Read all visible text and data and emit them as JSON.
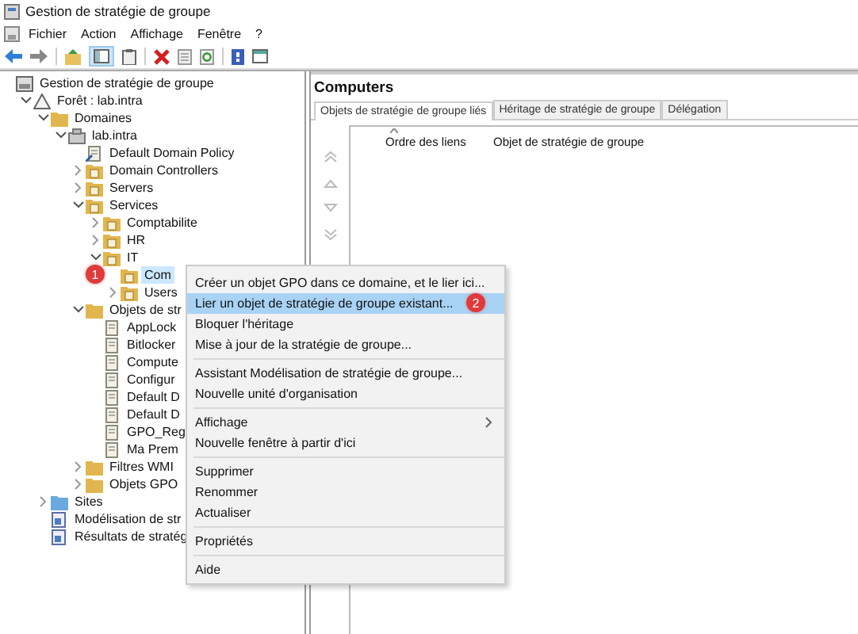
{
  "window": {
    "title": "Gestion de stratégie de groupe"
  },
  "menu_bar": [
    "Fichier",
    "Action",
    "Affichage",
    "Fenêtre",
    "?"
  ],
  "toolbar": {
    "console_tree_shown": true
  },
  "tree": [
    {
      "label": "Gestion de stratégie de groupe",
      "kind": "root",
      "selected": false,
      "children": [
        {
          "label": "Forêt : lab.intra",
          "kind": "forest",
          "expanded": true,
          "selected": false,
          "children": [
            {
              "label": "Domaines",
              "kind": "container",
              "expanded": true,
              "selected": false,
              "children": [
                {
                  "label": "lab.intra",
                  "kind": "domain",
                  "expanded": true,
                  "selected": false,
                  "children": [
                    {
                      "label": "Default Domain Policy",
                      "kind": "link",
                      "selected": false
                    },
                    {
                      "label": "Domain Controllers",
                      "kind": "ou",
                      "expanded": false,
                      "selected": false
                    },
                    {
                      "label": "Servers",
                      "kind": "ou",
                      "expanded": false,
                      "selected": false
                    },
                    {
                      "label": "Services",
                      "kind": "ou",
                      "expanded": true,
                      "selected": false,
                      "children": [
                        {
                          "label": "Comptabilite",
                          "kind": "ou",
                          "expanded": false,
                          "selected": false
                        },
                        {
                          "label": "HR",
                          "kind": "ou",
                          "expanded": false,
                          "selected": false
                        },
                        {
                          "label": "IT",
                          "kind": "ou",
                          "expanded": true,
                          "selected": false,
                          "children": [
                            {
                              "label": "Com",
                              "kind": "ou",
                              "selected": true,
                              "badge": "1"
                            },
                            {
                              "label": "Users",
                              "kind": "ou",
                              "expanded": false,
                              "selected": false
                            }
                          ]
                        }
                      ]
                    },
                    {
                      "label": "Objets de str",
                      "kind": "container",
                      "expanded": true,
                      "selected": false,
                      "children": [
                        {
                          "label": "AppLock",
                          "kind": "gpo",
                          "selected": false
                        },
                        {
                          "label": "Bitlocker",
                          "kind": "gpo",
                          "selected": false
                        },
                        {
                          "label": "Compute",
                          "kind": "gpo",
                          "selected": false
                        },
                        {
                          "label": "Configur",
                          "kind": "gpo",
                          "selected": false
                        },
                        {
                          "label": "Default D",
                          "kind": "gpo",
                          "selected": false
                        },
                        {
                          "label": "Default D",
                          "kind": "gpo",
                          "selected": false
                        },
                        {
                          "label": "GPO_Reg",
                          "kind": "gpo",
                          "selected": false
                        },
                        {
                          "label": "Ma Prem",
                          "kind": "gpo",
                          "selected": false
                        }
                      ]
                    },
                    {
                      "label": "Filtres WMI",
                      "kind": "container",
                      "expanded": false,
                      "selected": false
                    },
                    {
                      "label": "Objets GPO",
                      "kind": "container",
                      "expanded": false,
                      "selected": false
                    }
                  ]
                }
              ]
            },
            {
              "label": "Sites",
              "kind": "sites",
              "expanded": false,
              "selected": false
            },
            {
              "label": "Modélisation de str",
              "kind": "report",
              "selected": false
            },
            {
              "label": "Résultats de stratég",
              "kind": "report",
              "selected": false
            }
          ]
        }
      ]
    }
  ],
  "pane": {
    "title": "Computers",
    "tabs": [
      {
        "label": "Objets de stratégie de groupe liés",
        "selected": true
      },
      {
        "label": "Héritage de stratégie de groupe",
        "selected": false
      },
      {
        "label": "Délégation",
        "selected": false
      }
    ],
    "columns": [
      {
        "label": "Ordre des liens",
        "sorted": true
      },
      {
        "label": "Objet de stratégie de groupe"
      }
    ]
  },
  "context_menu": {
    "groups": [
      [
        {
          "label": "Créer un objet GPO dans ce domaine, et le lier ici...",
          "selected": false,
          "submenu": false
        },
        {
          "label": "Lier un objet de stratégie de groupe existant...",
          "selected": true,
          "submenu": false,
          "badge": "2"
        },
        {
          "label": "Bloquer l'héritage",
          "selected": false,
          "submenu": false
        },
        {
          "label": "Mise à jour de la stratégie de groupe...",
          "selected": false,
          "submenu": false
        }
      ],
      [
        {
          "label": "Assistant Modélisation de stratégie de groupe...",
          "selected": false,
          "submenu": false
        },
        {
          "label": "Nouvelle unité d'organisation",
          "selected": false,
          "submenu": false
        }
      ],
      [
        {
          "label": "Affichage",
          "selected": false,
          "submenu": true
        },
        {
          "label": "Nouvelle fenêtre à partir d'ici",
          "selected": false,
          "submenu": false
        }
      ],
      [
        {
          "label": "Supprimer",
          "selected": false,
          "submenu": false
        },
        {
          "label": "Renommer",
          "selected": false,
          "submenu": false
        },
        {
          "label": "Actualiser",
          "selected": false,
          "submenu": false
        }
      ],
      [
        {
          "label": "Propriétés",
          "selected": false,
          "submenu": false
        }
      ],
      [
        {
          "label": "Aide",
          "selected": false,
          "submenu": false
        }
      ]
    ]
  }
}
